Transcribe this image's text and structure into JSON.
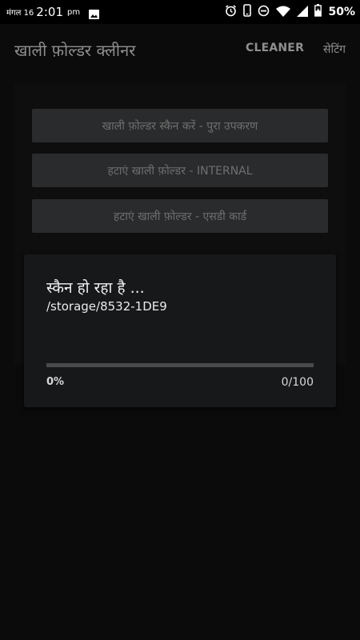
{
  "status_bar": {
    "day": "मंगल 16",
    "time": "2:01",
    "ampm": "pm",
    "battery": "50%",
    "icons": [
      "image-icon",
      "alarm-icon",
      "phone-icon",
      "dnd-icon",
      "wifi-icon",
      "signal-icon",
      "battery-icon"
    ]
  },
  "app_bar": {
    "title": "खाली फ़ोल्डर क्लीनर",
    "tab_cleaner": "CLEANER",
    "tab_settings": "सेटिंग"
  },
  "actions": {
    "scan_all": "खाली फ़ोल्डर स्कैन करें - पुरा उपकरण",
    "remove_internal": "हटाएं खाली फ़ोल्डर - INTERNAL",
    "remove_sdcard": "हटाएं खाली फ़ोल्डर - एसडी कार्ड"
  },
  "scan": {
    "title": "स्कैन हो रहा है ...",
    "path": "/storage/8532-1DE9",
    "progress_fraction": 0,
    "progress_percent_label": "0%",
    "progress_count_label": "0/100"
  },
  "colors": {
    "background": "#0b0b0c",
    "button": "#2a2b2c",
    "card": "#17181a",
    "track": "#4a4b4d"
  }
}
